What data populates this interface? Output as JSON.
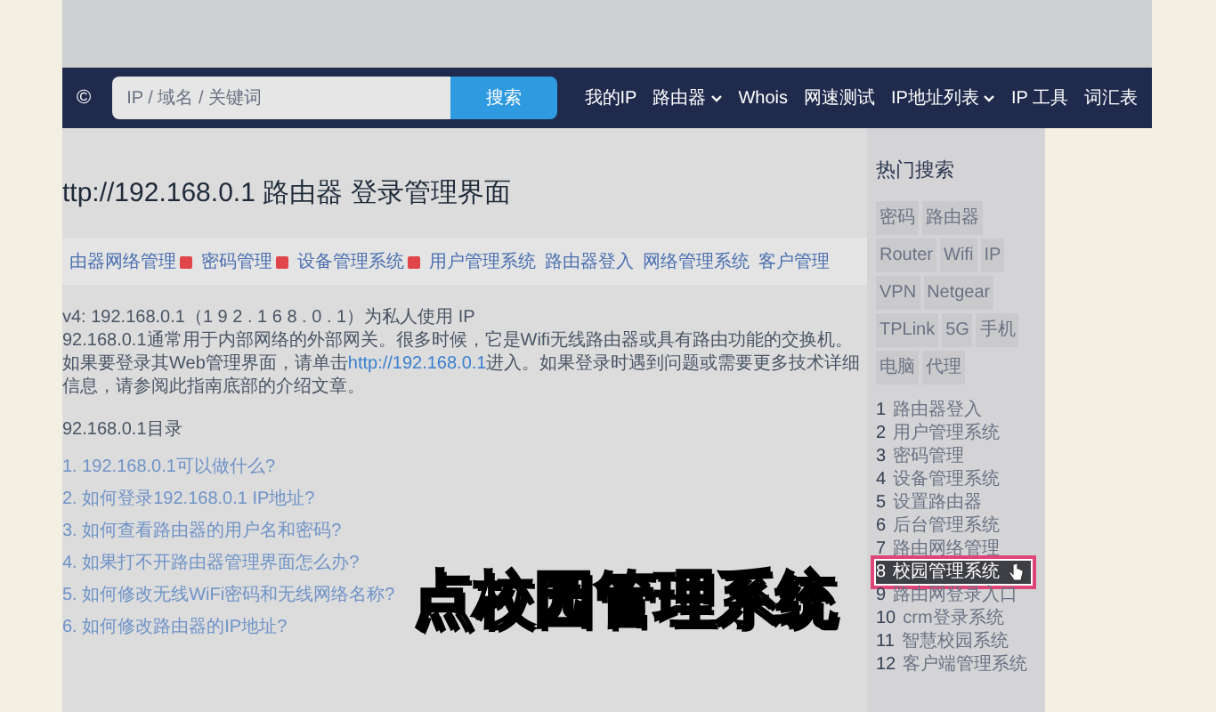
{
  "logo": "©",
  "search": {
    "placeholder": "IP / 域名 / 关键词",
    "button": "搜索"
  },
  "nav": [
    {
      "label": "我的IP",
      "dropdown": false
    },
    {
      "label": "路由器",
      "dropdown": true
    },
    {
      "label": "Whois",
      "dropdown": false
    },
    {
      "label": "网速测试",
      "dropdown": false
    },
    {
      "label": "IP地址列表",
      "dropdown": true
    },
    {
      "label": "IP 工具",
      "dropdown": false
    },
    {
      "label": "词汇表",
      "dropdown": false
    }
  ],
  "title": "ttp://192.168.0.1 路由器 登录管理界面",
  "tabs": [
    {
      "label": "由器网络管理",
      "badge": true
    },
    {
      "label": "密码管理",
      "badge": true
    },
    {
      "label": "设备管理系统",
      "badge": true
    },
    {
      "label": "用户管理系统",
      "badge": false
    },
    {
      "label": "路由器登入",
      "badge": false
    },
    {
      "label": "网络管理系统",
      "badge": false
    },
    {
      "label": "客户管理",
      "badge": false
    }
  ],
  "article": {
    "intro": "v4: 192.168.0.1（1 9 2 . 1 6 8 . 0 . 1）为私人使用 IP",
    "text_before": "92.168.0.1通常用于内部网络的外部网关。很多时候，它是Wifi无线路由器或具有路由功能的交换机。如果要登录其Web管理界面，请单击",
    "link": "http://192.168.0.1",
    "text_after": "进入。如果登录时遇到问题或需要更多技术详细信息，请参阅此指南底部的介绍文章。"
  },
  "toc_title": "92.168.0.1目录",
  "toc": [
    "1. 192.168.0.1可以做什么?",
    "2. 如何登录192.168.0.1 IP地址?",
    "3. 如何查看路由器的用户名和密码?",
    "4. 如果打不开路由器管理界面怎么办?",
    "5. 如何修改无线WiFi密码和无线网络名称?",
    "6. 如何修改路由器的IP地址?"
  ],
  "sidebar": {
    "title": "热门搜索",
    "tags": [
      "密码",
      "路由器",
      "Router",
      "Wifi",
      "IP",
      "VPN",
      "Netgear",
      "TPLink",
      "5G",
      "手机",
      "电脑",
      "代理"
    ],
    "list": [
      {
        "number": "1",
        "label": "路由器登入",
        "selected": false
      },
      {
        "number": "2",
        "label": "用户管理系统",
        "selected": false
      },
      {
        "number": "3",
        "label": "密码管理",
        "selected": false
      },
      {
        "number": "4",
        "label": "设备管理系统",
        "selected": false
      },
      {
        "number": "5",
        "label": "设置路由器",
        "selected": false
      },
      {
        "number": "6",
        "label": "后台管理系统",
        "selected": false
      },
      {
        "number": "7",
        "label": "路由网络管理",
        "selected": false
      },
      {
        "number": "8",
        "label": "校园管理系统",
        "selected": true
      },
      {
        "number": "9",
        "label": "路由网登录入口",
        "selected": false
      },
      {
        "number": "10",
        "label": "crm登录系统",
        "selected": false
      },
      {
        "number": "11",
        "label": "智慧校园系统",
        "selected": false
      },
      {
        "number": "12",
        "label": "客户端管理系统",
        "selected": false
      }
    ]
  },
  "caption": "点校园管理系统"
}
